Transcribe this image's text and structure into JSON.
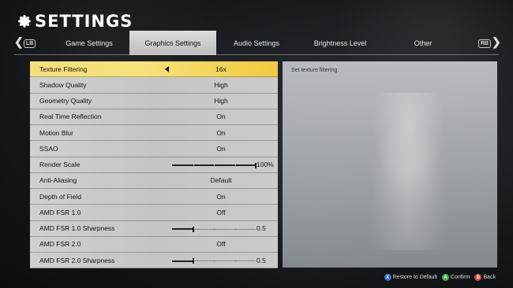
{
  "title": "SETTINGS",
  "icons": {
    "gear": "gear-icon"
  },
  "tabs": {
    "lb": "LB",
    "rb": "RB",
    "items": [
      {
        "label": "Game Settings"
      },
      {
        "label": "Graphics Settings",
        "active": true
      },
      {
        "label": "Audio Settings"
      },
      {
        "label": "Brightness Level"
      },
      {
        "label": "Other"
      }
    ]
  },
  "settings": [
    {
      "label": "Texture Filtering",
      "value": "16x",
      "selected": true
    },
    {
      "label": "Shadow Quality",
      "value": "High"
    },
    {
      "label": "Geometry Quality",
      "value": "High"
    },
    {
      "label": "Real Time Reflection",
      "value": "On"
    },
    {
      "label": "Motion Blur",
      "value": "On"
    },
    {
      "label": "SSAO",
      "value": "On"
    },
    {
      "label": "Render Scale",
      "value": "100%",
      "slider_level": 1.0
    },
    {
      "label": "Anti-Aliasing",
      "value": "Default"
    },
    {
      "label": "Depth of Field",
      "value": "On"
    },
    {
      "label": "AMD FSR 1.0",
      "value": "Off"
    },
    {
      "label": "AMD FSR 1.0 Sharpness",
      "value": "0.5",
      "slider_level": 0.25
    },
    {
      "label": "AMD FSR 2.0",
      "value": "Off"
    },
    {
      "label": "AMD FSR 2.0 Sharpness",
      "value": "0.5",
      "slider_level": 0.25
    }
  ],
  "description": "Set texture filtering.",
  "footer": {
    "restore": {
      "button": "X",
      "label": "Restore to Default",
      "color": "#3b6fd6"
    },
    "confirm": {
      "button": "A",
      "label": "Confirm",
      "color": "#3fae49"
    },
    "back": {
      "button": "B",
      "label": "Back",
      "color": "#d64a3b"
    }
  },
  "colors": {
    "selected_row": "#f6e27a",
    "row": "#c9cacb",
    "active_tab": "#d3d3d3"
  }
}
